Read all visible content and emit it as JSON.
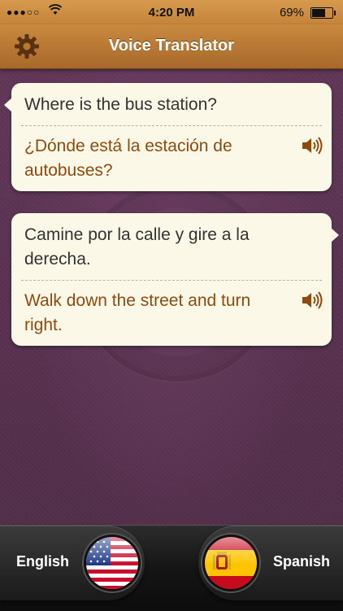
{
  "status_bar": {
    "signal": "●●●○○",
    "time": "4:20 PM",
    "battery": "69%"
  },
  "header": {
    "title": "Voice Translator",
    "settings_icon": "gear-icon"
  },
  "conversation": [
    {
      "source_text": "Where is the bus station?",
      "translated_text": "¿Dónde está la estación de autobuses?",
      "speaker_icon": "speaker-icon"
    },
    {
      "source_text": "Camine por la calle y gire a la derecha.",
      "translated_text": "Walk down the street and turn right.",
      "speaker_icon": "speaker-icon"
    }
  ],
  "languages": {
    "left": {
      "label": "English",
      "flag": "us-flag-icon"
    },
    "right": {
      "label": "Spanish",
      "flag": "spain-flag-icon"
    }
  },
  "colors": {
    "header": "#c4843a",
    "background": "#5a3452",
    "bubble": "#fcf8e8",
    "translation_text": "#8e4a0f"
  }
}
